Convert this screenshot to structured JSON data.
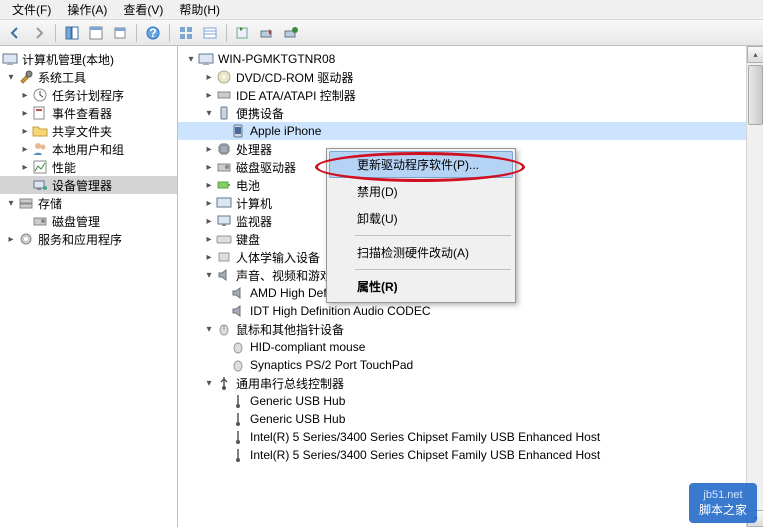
{
  "menu": {
    "file": "文件(F)",
    "action": "操作(A)",
    "view": "查看(V)",
    "help": "帮助(H)"
  },
  "left": {
    "root": "计算机管理(本地)",
    "tools": "系统工具",
    "sched": "任务计划程序",
    "evt": "事件查看器",
    "shared": "共享文件夹",
    "users": "本地用户和组",
    "perf": "性能",
    "devmgr": "设备管理器",
    "storage": "存储",
    "disk": "磁盘管理",
    "svc": "服务和应用程序"
  },
  "right": {
    "host": "WIN-PGMKTGTNR08",
    "dvd": "DVD/CD-ROM 驱动器",
    "ide": "IDE ATA/ATAPI 控制器",
    "portable": "便携设备",
    "iphone": "Apple iPhone",
    "cpu": "处理器",
    "diskdrv": "磁盘驱动器",
    "battery": "电池",
    "computer": "计算机",
    "monitor": "监视器",
    "keyboard": "键盘",
    "hid": "人体学输入设备",
    "sound": "声音、视频和游戏控制器",
    "amd": "AMD High Definition Audio Device",
    "idt": "IDT High Definition Audio CODEC",
    "mouse": "鼠标和其他指针设备",
    "hidmouse": "HID-compliant mouse",
    "synaptics": "Synaptics PS/2 Port TouchPad",
    "usb": "通用串行总线控制器",
    "hub1": "Generic USB Hub",
    "hub2": "Generic USB Hub",
    "intel1": "Intel(R) 5 Series/3400 Series Chipset Family USB Enhanced Host",
    "intel2": "Intel(R) 5 Series/3400 Series Chipset Family USB Enhanced Host"
  },
  "ctx": {
    "update": "更新驱动程序软件(P)...",
    "disable": "禁用(D)",
    "uninstall": "卸载(U)",
    "scan": "扫描检测硬件改动(A)",
    "props": "属性(R)"
  },
  "watermark": {
    "top": "jb51.net",
    "bot": "脚本之家"
  }
}
